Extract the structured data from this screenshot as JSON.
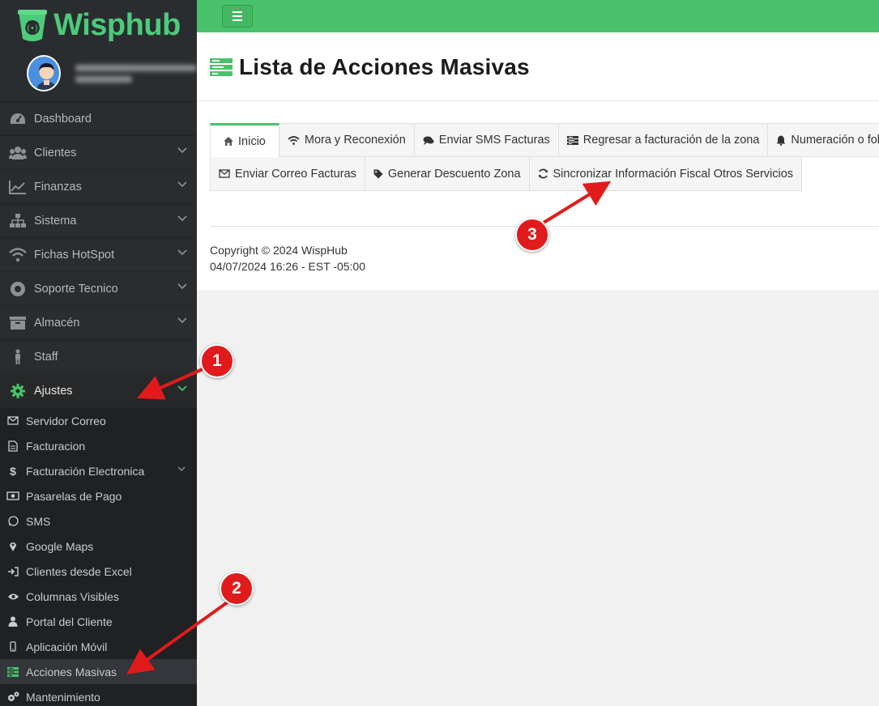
{
  "brand": {
    "name": "Wisphub"
  },
  "sidebar": {
    "items": [
      {
        "label": "Dashboard",
        "icon": "dashboard-icon"
      },
      {
        "label": "Clientes",
        "icon": "users-icon"
      },
      {
        "label": "Finanzas",
        "icon": "chart-line-icon"
      },
      {
        "label": "Sistema",
        "icon": "sitemap-icon"
      },
      {
        "label": "Fichas HotSpot",
        "icon": "wifi-icon"
      },
      {
        "label": "Soporte Tecnico",
        "icon": "lifebuoy-icon"
      },
      {
        "label": "Almacén",
        "icon": "archive-icon"
      },
      {
        "label": "Staff",
        "icon": "person-icon"
      },
      {
        "label": "Ajustes",
        "icon": "gear-icon"
      }
    ],
    "submenu": [
      {
        "label": "Servidor Correo",
        "icon": "envelope-icon"
      },
      {
        "label": "Facturacion",
        "icon": "document-icon"
      },
      {
        "label": "Facturación Electronica",
        "icon": "dollar-icon"
      },
      {
        "label": "Pasarelas de Pago",
        "icon": "money-icon"
      },
      {
        "label": "SMS",
        "icon": "whatsapp-icon"
      },
      {
        "label": "Google Maps",
        "icon": "map-marker-icon"
      },
      {
        "label": "Clientes desde Excel",
        "icon": "sign-in-icon"
      },
      {
        "label": "Columnas Visibles",
        "icon": "eye-icon"
      },
      {
        "label": "Portal del Cliente",
        "icon": "user-icon"
      },
      {
        "label": "Aplicación Móvil",
        "icon": "mobile-icon"
      },
      {
        "label": "Acciones Masivas",
        "icon": "tasks-icon"
      },
      {
        "label": "Mantenimiento",
        "icon": "cogs-icon"
      }
    ]
  },
  "page": {
    "title": "Lista de Acciones Masivas"
  },
  "tabs": {
    "row1": [
      {
        "label": "Inicio",
        "icon": "home-icon"
      },
      {
        "label": "Mora y Reconexión",
        "icon": "wifi-icon"
      },
      {
        "label": "Enviar SMS Facturas",
        "icon": "comments-icon"
      },
      {
        "label": "Regresar a facturación de la zona",
        "icon": "tasks-icon"
      },
      {
        "label": "Numeración o folios",
        "icon": "bell-icon"
      }
    ],
    "row2": [
      {
        "label": "Enviar Correo Facturas",
        "icon": "envelope-icon"
      },
      {
        "label": "Generar Descuento Zona",
        "icon": "tag-icon"
      },
      {
        "label": "Sincronizar Información Fiscal Otros Servicios",
        "icon": "refresh-icon"
      }
    ]
  },
  "footer": {
    "copyright": "Copyright © 2024 WispHub",
    "datetime": "04/07/2024 16:26 - EST -05:00"
  },
  "annotations": [
    "1",
    "2",
    "3"
  ],
  "colors": {
    "accent": "#4ac26b",
    "sidebar": "#2a2d30",
    "annotation": "#e11b1b"
  }
}
